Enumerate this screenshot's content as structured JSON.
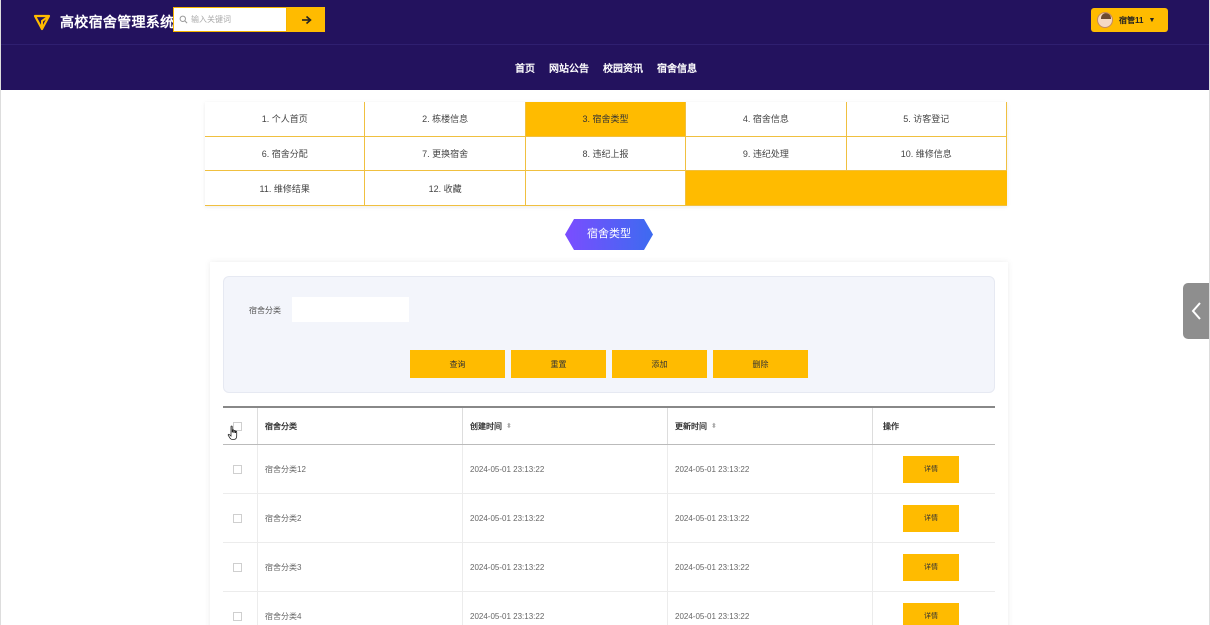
{
  "header": {
    "title": "高校宿舍管理系统",
    "logo_icon": "send-arrow-icon",
    "search_placeholder": "输入关键词",
    "search_icon": "search-icon",
    "search_button_icon": "arrow-right-icon",
    "user_name": "宿管11",
    "accent_color": "#ffbb00",
    "bg_color": "#23125e"
  },
  "nav": {
    "items": [
      {
        "label": "首页"
      },
      {
        "label": "网站公告"
      },
      {
        "label": "校园资讯"
      },
      {
        "label": "宿舍信息"
      }
    ]
  },
  "menu": {
    "items": [
      {
        "label": "1. 个人首页"
      },
      {
        "label": "2. 栋楼信息"
      },
      {
        "label": "3. 宿舍类型",
        "active": true
      },
      {
        "label": "4. 宿舍信息"
      },
      {
        "label": "5. 访客登记"
      },
      {
        "label": "6. 宿舍分配"
      },
      {
        "label": "7. 更换宿舍"
      },
      {
        "label": "8. 违纪上报"
      },
      {
        "label": "9. 违纪处理"
      },
      {
        "label": "10. 维修信息"
      },
      {
        "label": "11. 维修结果"
      },
      {
        "label": "12. 收藏"
      }
    ]
  },
  "section": {
    "title": "宿舍类型"
  },
  "filter": {
    "label": "宿舍分类",
    "value": "",
    "buttons": {
      "query": "查询",
      "reset": "重置",
      "add": "添加",
      "delete": "删除"
    }
  },
  "table": {
    "headers": {
      "category": "宿舍分类",
      "created": "创建时间",
      "updated": "更新时间",
      "actions": "操作"
    },
    "detail_label": "详情",
    "rows": [
      {
        "category": "宿舍分类12",
        "created": "2024-05-01 23:13:22",
        "updated": "2024-05-01 23:13:22"
      },
      {
        "category": "宿舍分类2",
        "created": "2024-05-01 23:13:22",
        "updated": "2024-05-01 23:13:22"
      },
      {
        "category": "宿舍分类3",
        "created": "2024-05-01 23:13:22",
        "updated": "2024-05-01 23:13:22"
      },
      {
        "category": "宿舍分类4",
        "created": "2024-05-01 23:13:22",
        "updated": "2024-05-01 23:13:22"
      }
    ]
  },
  "side_tab_icon": "chevron-left-icon"
}
